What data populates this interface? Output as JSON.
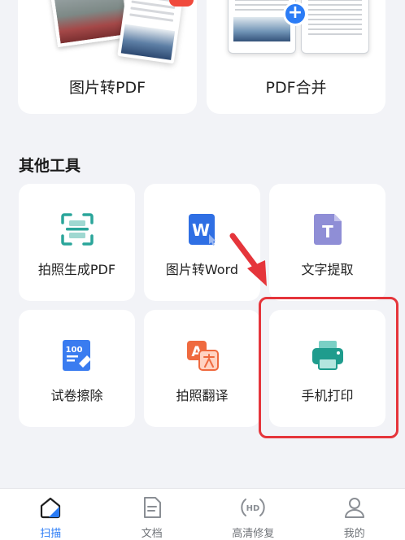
{
  "top_tools": [
    {
      "label": "图片转PDF"
    },
    {
      "label": "PDF合并"
    }
  ],
  "section": {
    "title": "其他工具"
  },
  "tools": [
    {
      "label": "拍照生成PDF",
      "icon": "scan-frame-icon",
      "color": "#2aa59a"
    },
    {
      "label": "图片转Word",
      "icon": "word-doc-icon",
      "color": "#2f6fe4",
      "glyph": "W"
    },
    {
      "label": "文字提取",
      "icon": "text-extract-icon",
      "color": "#7a79c9",
      "glyph": "T"
    },
    {
      "label": "试卷擦除",
      "icon": "exam-erase-icon",
      "color": "#3a7cf0",
      "glyph": "100"
    },
    {
      "label": "拍照翻译",
      "icon": "translate-icon",
      "color": "#ef6a3f",
      "glyph": "A"
    },
    {
      "label": "手机打印",
      "icon": "printer-icon",
      "color": "#1f9c8d"
    }
  ],
  "highlight_color": "#e5353b",
  "nav": [
    {
      "label": "扫描",
      "icon": "home-scan-icon",
      "active": true
    },
    {
      "label": "文档",
      "icon": "document-icon",
      "active": false
    },
    {
      "label": "高清修复",
      "icon": "hd-icon",
      "active": false,
      "glyph": "HD"
    },
    {
      "label": "我的",
      "icon": "profile-icon",
      "active": false
    }
  ],
  "colors": {
    "accent": "#2b7cf6",
    "background": "#f2f3f7"
  }
}
